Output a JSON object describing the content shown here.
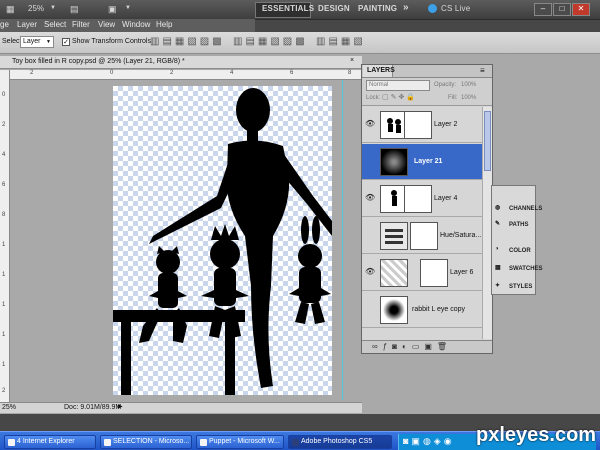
{
  "app": {
    "zoom": "25%",
    "workspaces": [
      "ESSENTIALS",
      "DESIGN",
      "PAINTING"
    ],
    "more_workspaces": "»",
    "cs_live": "CS Live",
    "window_controls": [
      "–",
      "□",
      "✕"
    ]
  },
  "menu": {
    "items": [
      "ge",
      "Layer",
      "Select",
      "Filter",
      "View",
      "Window",
      "Help"
    ]
  },
  "options": {
    "select_label": "Select:",
    "select_value": "Layer",
    "transform_label": "Show Transform Controls"
  },
  "document": {
    "tab_title": "Toy box filled in R copy.psd @ 25% (Layer 21, RGB/8) *",
    "ruler_top_ticks": [
      "2",
      "0",
      "2",
      "4",
      "6",
      "8"
    ],
    "ruler_left_ticks": [
      "0",
      "2",
      "4",
      "6",
      "8",
      "1",
      "1",
      "1",
      "1",
      "1",
      "2"
    ],
    "status_zoom": "25%",
    "status_doc": "Doc: 9.01M/89.9M"
  },
  "layers_panel": {
    "title": "LAYERS",
    "blend_mode": "Normal",
    "opacity_label": "Opacity:",
    "opacity_value": "100%",
    "lock_label": "Lock:",
    "fill_label": "Fill:",
    "fill_value": "100%",
    "layers": [
      {
        "name": "Layer 2",
        "visible": true,
        "selected": false
      },
      {
        "name": "Layer 21",
        "visible": false,
        "selected": true
      },
      {
        "name": "Layer 4",
        "visible": true,
        "selected": false
      },
      {
        "name": "Hue/Satura...",
        "visible": false,
        "selected": false
      },
      {
        "name": "Layer 6",
        "visible": true,
        "selected": false
      },
      {
        "name": "rabbit L eye copy",
        "visible": false,
        "selected": false
      }
    ]
  },
  "side_panel": {
    "items": [
      "CHANNELS",
      "PATHS",
      "COLOR",
      "SWATCHES",
      "STYLES"
    ]
  },
  "taskbar": {
    "tasks": [
      {
        "label": "4 Internet Explorer",
        "active": false
      },
      {
        "label": "SELECTION - Microso...",
        "active": false
      },
      {
        "label": "Puppet - Microsoft W...",
        "active": false
      },
      {
        "label": "Adobe Photoshop CS5",
        "active": true
      }
    ]
  },
  "watermark": "pxleyes.com",
  "colors": {
    "selection": "#3868c8",
    "taskbar": "#2a63d4",
    "app_dark": "#474747"
  }
}
